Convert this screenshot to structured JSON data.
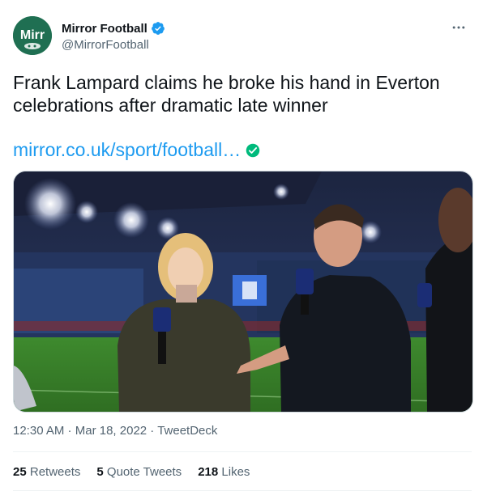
{
  "account": {
    "display_name": "Mirror Football",
    "handle": "@MirrorFootball",
    "avatar_text": "Mirr"
  },
  "tweet": {
    "text": "Frank Lampard claims he broke his hand in Everton celebrations after dramatic late winner",
    "link_text": "mirror.co.uk/sport/football…"
  },
  "meta": {
    "time": "12:30 AM",
    "sep": " · ",
    "date": "Mar 18, 2022",
    "source": "TweetDeck"
  },
  "stats": {
    "retweets_count": "25",
    "retweets_label": "Retweets",
    "quotes_count": "5",
    "quotes_label": "Quote Tweets",
    "likes_count": "218",
    "likes_label": "Likes"
  },
  "icons": {
    "more": "more-icon",
    "verified": "verified-badge-icon",
    "link_check": "verified-link-icon"
  },
  "colors": {
    "link": "#1d9bf0",
    "verified": "#1d9bf0",
    "link_check": "#00ba7c",
    "avatar_bg": "#1f6f52"
  }
}
